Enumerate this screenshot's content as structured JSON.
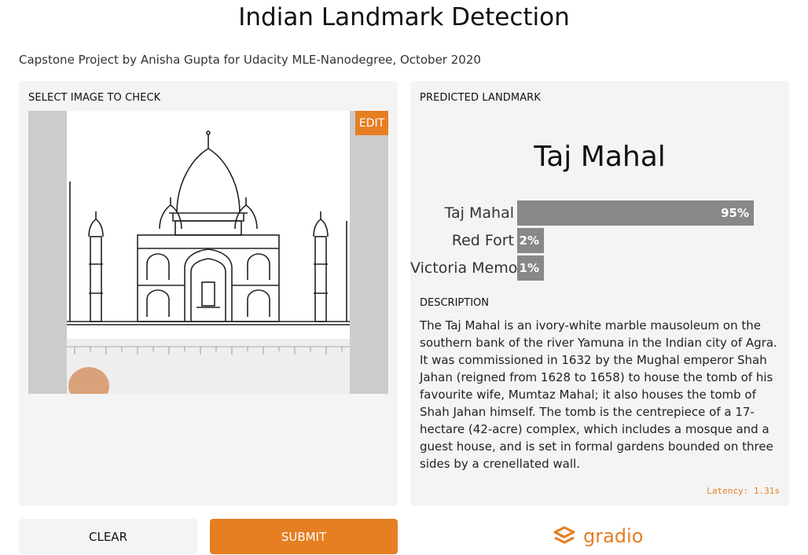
{
  "header": {
    "title": "Indian Landmark Detection",
    "subtitle": "Capstone Project by Anisha Gupta for Udacity MLE-Nanodegree, October 2020"
  },
  "input_panel": {
    "label": "SELECT IMAGE TO CHECK",
    "edit_label": "EDIT",
    "image_icon": "taj-mahal-sketch-image"
  },
  "output_panel": {
    "label": "PREDICTED LANDMARK",
    "predicted": "Taj Mahal",
    "confidences": [
      {
        "label": "Taj Mahal",
        "percent_text": "95%",
        "value": 0.95
      },
      {
        "label": "Red Fort",
        "percent_text": "2%",
        "value": 0.02
      },
      {
        "label": "Victoria Memorial",
        "percent_text": "1%",
        "value": 0.01
      }
    ],
    "description_label": "DESCRIPTION",
    "description": "The Taj Mahal is an ivory-white marble mausoleum on the southern bank of the river Yamuna in the Indian city of Agra. It was commissioned in 1632 by the Mughal emperor Shah Jahan (reigned from 1628 to 1658) to house the tomb of his favourite wife, Mumtaz Mahal; it also houses the tomb of Shah Jahan himself. The tomb is the centrepiece of a 17-hectare (42-acre) complex, which includes a mosque and a guest house, and is set in formal gardens bounded on three sides by a crenellated wall.",
    "latency": "Latency: 1.31s"
  },
  "actions": {
    "clear_label": "CLEAR",
    "submit_label": "SUBMIT"
  },
  "footer": {
    "brand": "gradio",
    "brand_icon": "gradio-logo-icon"
  },
  "colors": {
    "accent": "#e67e22",
    "panel_bg": "#f4f4f4",
    "bar": "#888888"
  }
}
